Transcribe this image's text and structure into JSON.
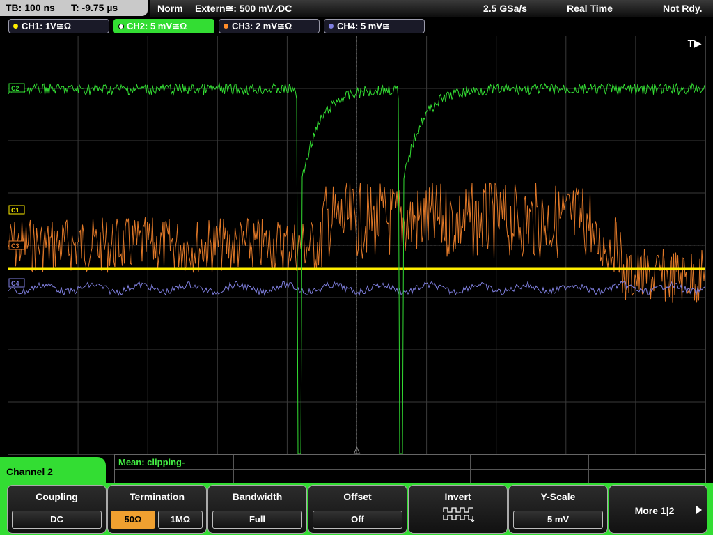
{
  "header": {
    "timebase": "TB: 100 ns",
    "trigger_time": "T: -9.75 µs",
    "mode": "Norm",
    "trigger_source": "Extern≅: 500 mV ⁄DC",
    "sample_rate": "2.5 GSa/s",
    "acq_mode": "Real Time",
    "state": "Not Rdy."
  },
  "channels": [
    {
      "label": "CH1: 1V≅Ω",
      "color": "#ffee00",
      "active": false
    },
    {
      "label": "CH2: 5 mV≅Ω",
      "color": "#33dd33",
      "active": true
    },
    {
      "label": "CH3: 2 mV≅Ω",
      "color": "#ff8c2a",
      "active": false
    },
    {
      "label": "CH4: 5 mV≅",
      "color": "#8080e0",
      "active": false
    }
  ],
  "screen": {
    "trigger_marker": "T▶",
    "markers": [
      "C1",
      "C3",
      "C4",
      "C2"
    ]
  },
  "measurement": {
    "label": "Mean: clipping-"
  },
  "menu": {
    "panel_title": "Channel 2",
    "coupling": {
      "title": "Coupling",
      "value": "DC"
    },
    "termination": {
      "title": "Termination",
      "options": [
        "50Ω",
        "1MΩ"
      ],
      "selected": "50Ω"
    },
    "bandwidth": {
      "title": "Bandwidth",
      "value": "Full"
    },
    "offset": {
      "title": "Offset",
      "value": "Off"
    },
    "invert": {
      "title": "Invert",
      "icon": "invert-waveform-icon"
    },
    "yscale": {
      "title": "Y-Scale",
      "value": "5 mV"
    },
    "more": {
      "label": "More 1|2"
    }
  }
}
